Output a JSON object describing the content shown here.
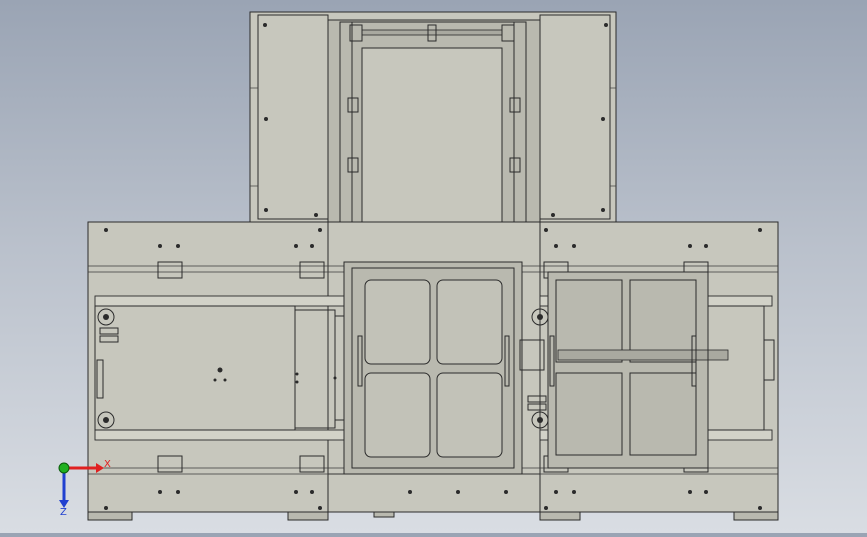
{
  "viewport": {
    "background_top": "#9aa4b4",
    "background_bottom": "#d9dde3",
    "model_color": "#c7c7bd",
    "edge_color": "#2b2b2b"
  },
  "triad": {
    "x_label": "X",
    "z_label": "Z",
    "x_color": "#e02020",
    "y_color": "#20b020",
    "z_color": "#2040d0"
  }
}
